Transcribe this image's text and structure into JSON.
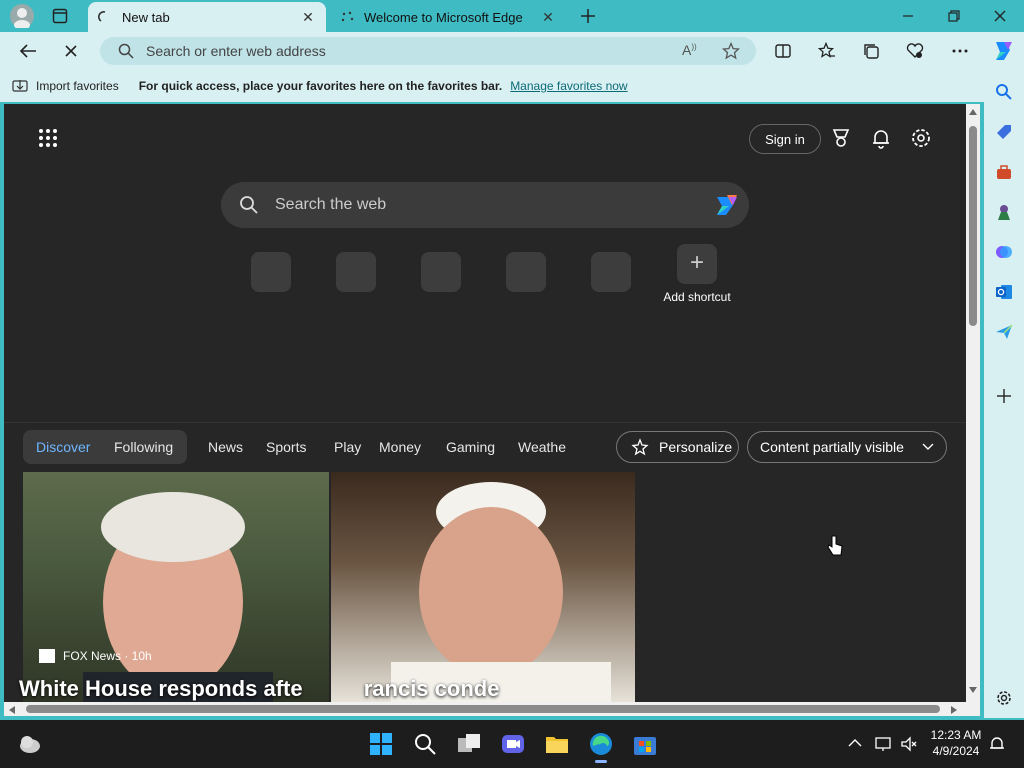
{
  "tabs": [
    {
      "label": "New tab",
      "active": true
    },
    {
      "label": "Welcome to Microsoft Edge",
      "active": false
    }
  ],
  "address_bar": {
    "placeholder": "Search or enter web address"
  },
  "favorites_bar": {
    "import_label": "Import favorites",
    "message": "For quick access, place your favorites here on the favorites bar.",
    "manage_link": "Manage favorites now"
  },
  "newtab": {
    "sign_in": "Sign in",
    "search_placeholder": "Search the web",
    "add_shortcut": "Add shortcut"
  },
  "feed": {
    "pill_tabs": [
      "Discover",
      "Following"
    ],
    "tabs": [
      "News",
      "Sports",
      "Play",
      "Money",
      "Gaming",
      "Weathe"
    ],
    "personalize": "Personalize",
    "content_visibility": "Content partially visible",
    "article": {
      "source": "FOX News · 10h",
      "headline": "White House responds afte          rancis conde"
    }
  },
  "taskbar": {
    "time": "12:23 AM",
    "date": "4/9/2024"
  },
  "colors": {
    "frame": "#3fbcc3",
    "toolbar": "#d9f0f2",
    "page_bg": "#262626",
    "discover_accent": "#6fb6ff"
  }
}
